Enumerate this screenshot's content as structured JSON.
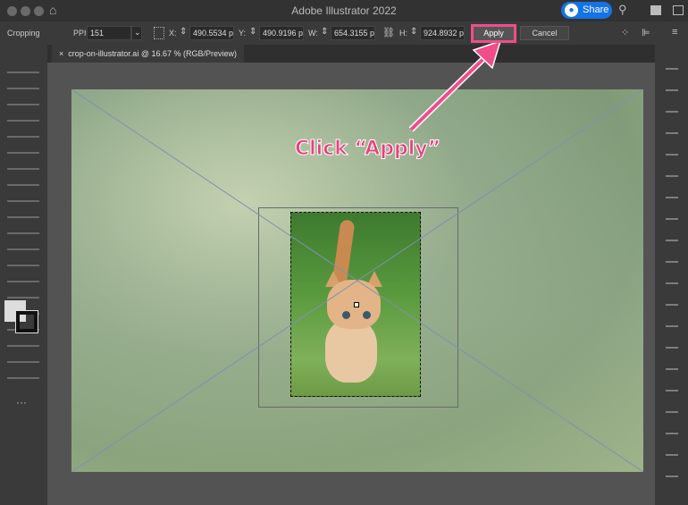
{
  "app": {
    "title": "Adobe Illustrator 2022",
    "share_label": "Share"
  },
  "control_bar": {
    "mode": "Cropping",
    "ppi_label": "PPI:",
    "ppi_value": "151",
    "x_label": "X:",
    "x_value": "490.5534 px",
    "y_label": "Y:",
    "y_value": "490.9196 px",
    "w_label": "W:",
    "w_value": "654.3155 px",
    "h_label": "H:",
    "h_value": "924.8932 px",
    "apply_label": "Apply",
    "cancel_label": "Cancel"
  },
  "document_tab": {
    "close": "×",
    "label": "crop-on-illustrator.ai @ 16.67 % (RGB/Preview)"
  },
  "annotation": {
    "text": "Click “Apply”",
    "color": "#e8407c"
  }
}
